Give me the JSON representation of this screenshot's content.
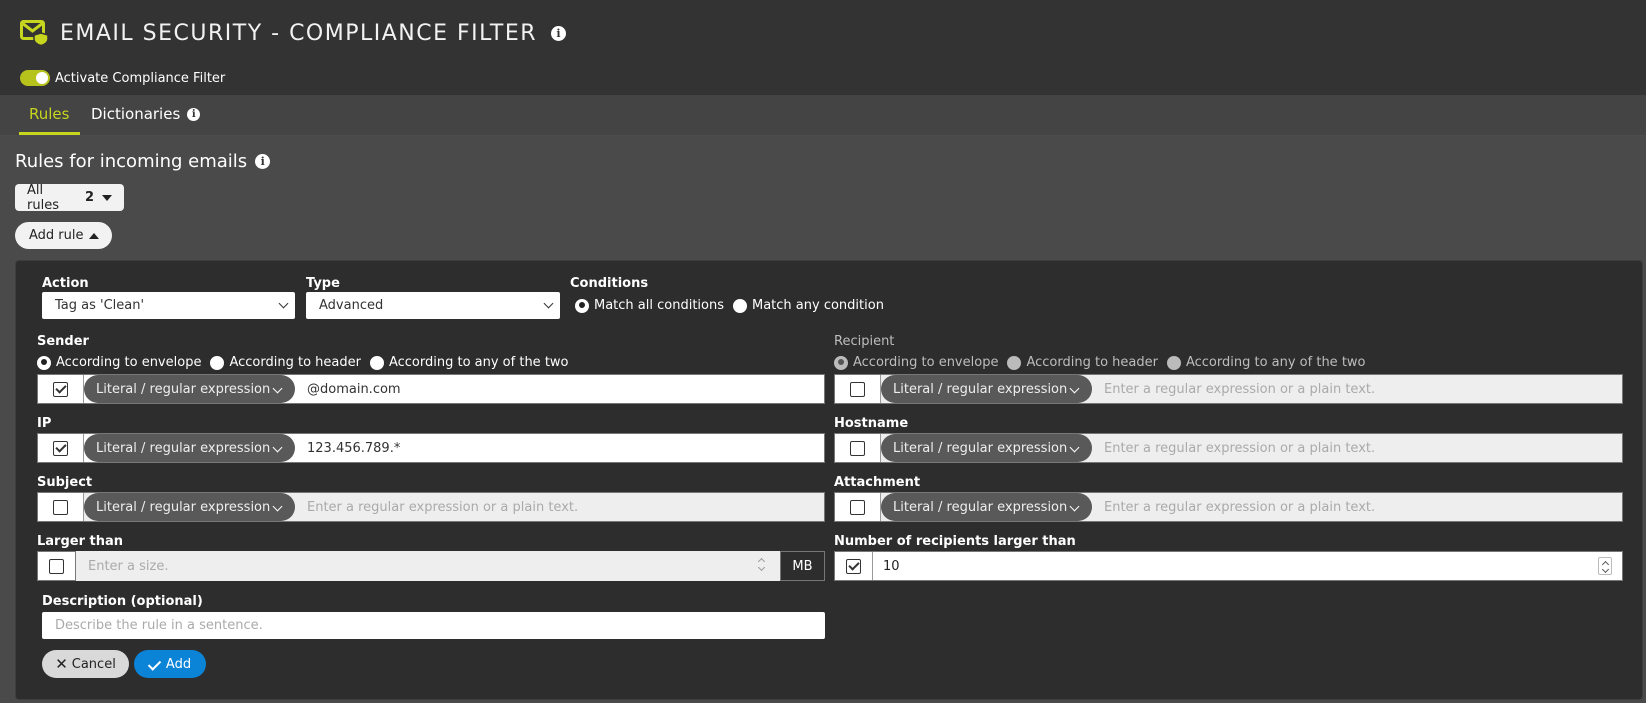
{
  "header": {
    "title": "EMAIL SECURITY - COMPLIANCE FILTER",
    "title_icon": "shield-envelope-icon",
    "activate_label": "Activate Compliance Filter",
    "activate_on": true
  },
  "tabs": [
    {
      "label": "Rules",
      "active": true
    },
    {
      "label": "Dictionaries",
      "active": false
    }
  ],
  "section": {
    "title": "Rules for incoming emails",
    "all_rules_label": "All rules",
    "all_rules_count": "2",
    "add_rule_label": "Add rule"
  },
  "form": {
    "action": {
      "label": "Action",
      "value": "Tag as 'Clean'"
    },
    "type": {
      "label": "Type",
      "value": "Advanced"
    },
    "conditions": {
      "label": "Conditions",
      "options": [
        "Match all conditions",
        "Match any condition"
      ],
      "selected": 0
    },
    "sender": {
      "label": "Sender",
      "options": [
        "According to envelope",
        "According to header",
        "According to any of the two"
      ],
      "checked": true,
      "mode": "Literal / regular expression",
      "value": "@domain.com"
    },
    "recipient": {
      "label": "Recipient",
      "options": [
        "According to envelope",
        "According to header",
        "According to any of the two"
      ],
      "checked": false,
      "mode": "Literal / regular expression",
      "placeholder": "Enter a regular expression or a plain text."
    },
    "ip": {
      "label": "IP",
      "checked": true,
      "mode": "Literal / regular expression",
      "value": "123.456.789.*"
    },
    "hostname": {
      "label": "Hostname",
      "checked": false,
      "mode": "Literal / regular expression",
      "placeholder": "Enter a regular expression or a plain text."
    },
    "subject": {
      "label": "Subject",
      "checked": false,
      "mode": "Literal / regular expression",
      "placeholder": "Enter a regular expression or a plain text."
    },
    "attachment": {
      "label": "Attachment",
      "checked": false,
      "mode": "Literal / regular expression",
      "placeholder": "Enter a regular expression or a plain text."
    },
    "larger_than": {
      "label": "Larger than",
      "checked": false,
      "placeholder": "Enter a size.",
      "unit": "MB"
    },
    "num_recipients": {
      "label": "Number of recipients larger than",
      "checked": true,
      "value": "10"
    },
    "description": {
      "label": "Description (optional)",
      "placeholder": "Describe the rule in a sentence."
    },
    "cancel_label": "Cancel",
    "add_label": "Add"
  },
  "colors": {
    "accent": "#c6d51d",
    "primary_button": "#0b84d8",
    "panel": "#2d2d2d"
  }
}
